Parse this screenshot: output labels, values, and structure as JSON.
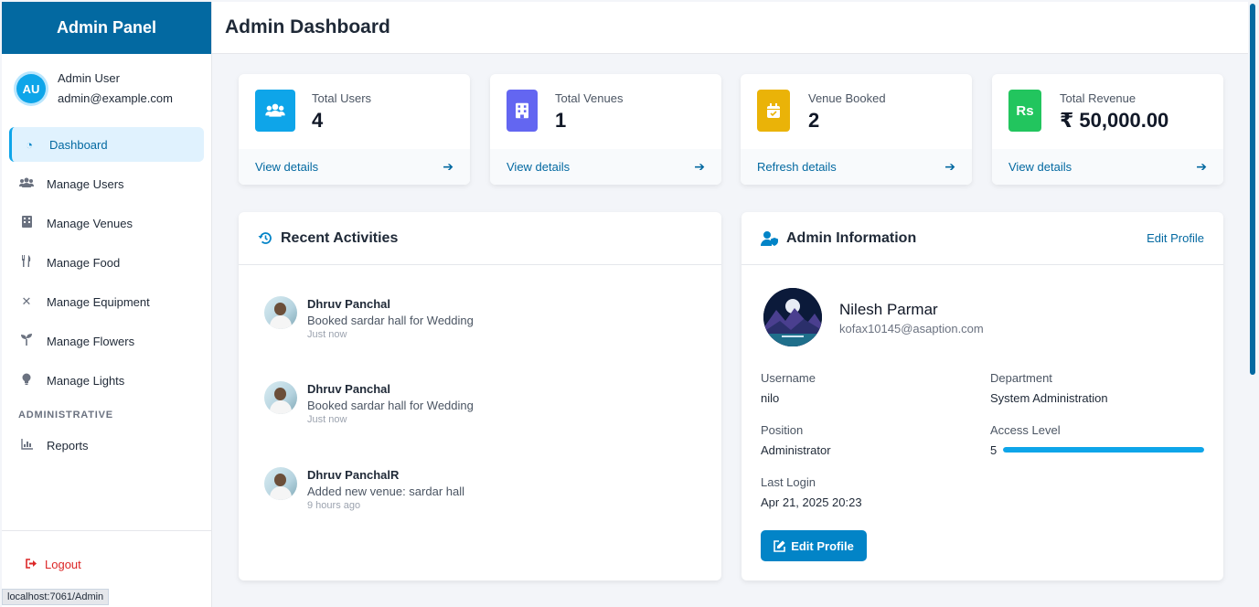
{
  "sidebar": {
    "title": "Admin Panel",
    "user": {
      "initials": "AU",
      "name": "Admin User",
      "email": "admin@example.com"
    },
    "items": [
      {
        "label": "Dashboard",
        "icon": "dashboard-icon",
        "active": true
      },
      {
        "label": "Manage Users",
        "icon": "users-icon"
      },
      {
        "label": "Manage Venues",
        "icon": "building-icon"
      },
      {
        "label": "Manage Food",
        "icon": "utensils-icon"
      },
      {
        "label": "Manage Equipment",
        "icon": "tools-icon"
      },
      {
        "label": "Manage Flowers",
        "icon": "seedling-icon"
      },
      {
        "label": "Manage Lights",
        "icon": "lightbulb-icon"
      }
    ],
    "section_label": "ADMINISTRATIVE",
    "reports_label": "Reports",
    "logout_label": "Logout"
  },
  "header": {
    "title": "Admin Dashboard"
  },
  "stats": [
    {
      "label": "Total Users",
      "value": "4",
      "link": "View details",
      "color": "#0ea5e9",
      "icon": "users-icon"
    },
    {
      "label": "Total Venues",
      "value": "1",
      "link": "View details",
      "color": "#6366f1",
      "icon": "building-icon"
    },
    {
      "label": "Venue Booked",
      "value": "2",
      "link": "Refresh details",
      "color": "#eab308",
      "icon": "calendar-check-icon"
    },
    {
      "label": "Total Revenue",
      "value": "₹ 50,000.00",
      "link": "View details",
      "color": "#22c55e",
      "icon": "rupee-icon"
    }
  ],
  "activities": {
    "title": "Recent Activities",
    "items": [
      {
        "name": "Dhruv Panchal",
        "desc": "Booked sardar hall for Wedding",
        "time": "Just now"
      },
      {
        "name": "Dhruv Panchal",
        "desc": "Booked sardar hall for Wedding",
        "time": "Just now"
      },
      {
        "name": "Dhruv PanchalR",
        "desc": "Added new venue: sardar hall",
        "time": "9 hours ago"
      }
    ]
  },
  "admin": {
    "title": "Admin Information",
    "edit_link": "Edit Profile",
    "name": "Nilesh Parmar",
    "email": "kofax10145@asaption.com",
    "username_label": "Username",
    "username": "nilo",
    "department_label": "Department",
    "department": "System Administration",
    "position_label": "Position",
    "position": "Administrator",
    "access_label": "Access Level",
    "access": "5",
    "access_fraction": 1.0,
    "last_login_label": "Last Login",
    "last_login": "Apr 21, 2025 20:23",
    "edit_button": "Edit Profile"
  },
  "status_url": "localhost:7061/Admin"
}
